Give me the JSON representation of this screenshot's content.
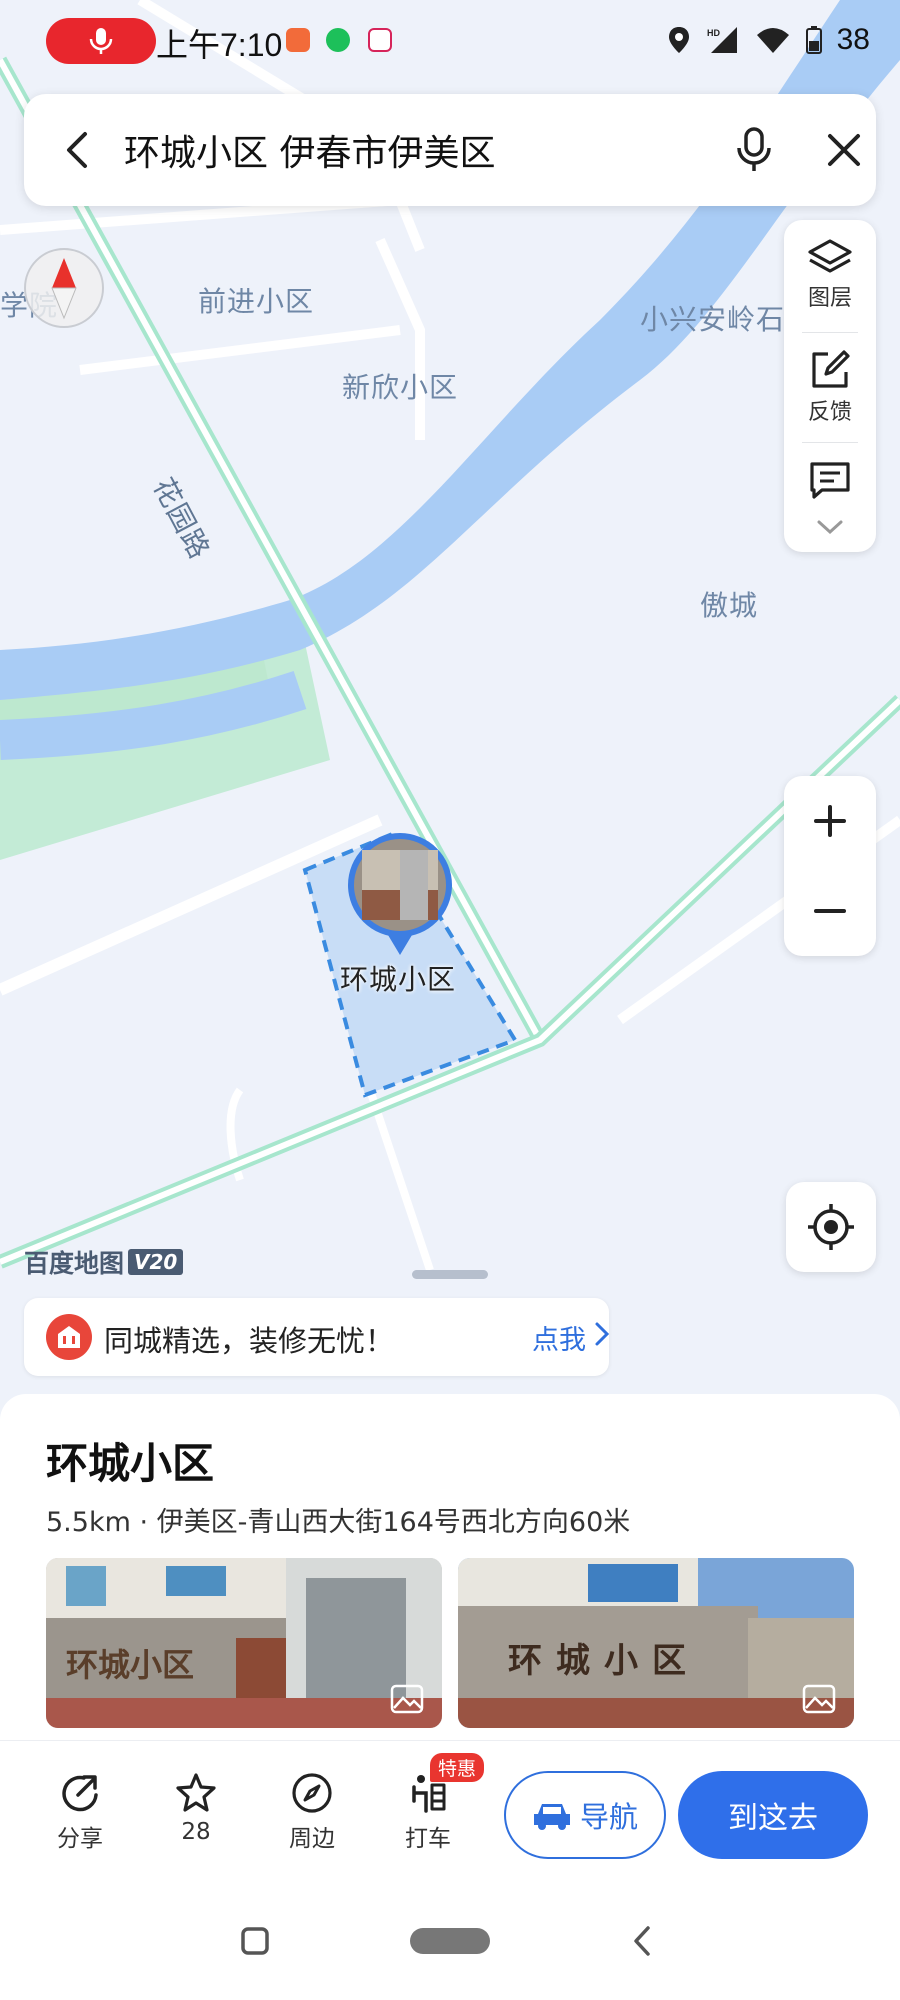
{
  "status_bar": {
    "time": "上午7:10",
    "battery": "38",
    "signal_tag": "HD"
  },
  "search": {
    "query": "环城小区 伊春市伊美区"
  },
  "map": {
    "labels": {
      "qianjin": "前进小区",
      "xinxin": "新欣小区",
      "xiaoxing": "小兴安岭石",
      "huayuan_road": "花园路",
      "aocheng": "傲城",
      "partial_left": "学院",
      "poi_marker": "环城小区"
    },
    "logo": "百度地图",
    "logo_version": "V20"
  },
  "tools": {
    "layers": "图层",
    "feedback": "反馈"
  },
  "promo": {
    "text": "同城精选，装修无忧！",
    "action": "点我"
  },
  "poi": {
    "title": "环城小区",
    "subtitle": "5.5km · 伊美区-青山西大街164号西北方向60米",
    "photo_text": "环城小区"
  },
  "actions": {
    "share": "分享",
    "favorite": "28",
    "nearby": "周边",
    "taxi": "打车",
    "taxi_tag": "特惠",
    "navigate": "导航",
    "go_here": "到这去"
  },
  "colors": {
    "accent": "#2f6fea",
    "river": "#a9ccf5",
    "road": "#a9e6cf",
    "park": "#bfe8d2"
  }
}
